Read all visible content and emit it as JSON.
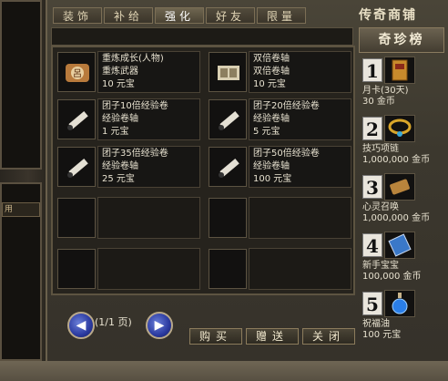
{
  "tabs": [
    {
      "label": "装饰",
      "active": false
    },
    {
      "label": "补给",
      "active": false
    },
    {
      "label": "强化",
      "active": true
    },
    {
      "label": "好友",
      "active": false
    },
    {
      "label": "限量",
      "active": false
    }
  ],
  "shop_title": "传奇商铺",
  "left_panel_fragment": "用",
  "items": [
    {
      "icon": "scroll-seal-icon",
      "name": "重炼成长(人物)",
      "desc": "重炼武器",
      "price": "10 元宝"
    },
    {
      "icon": "double-scroll-icon",
      "name": "双倍卷轴",
      "desc": "双倍卷轴",
      "price": "10 元宝"
    },
    {
      "icon": "exp-scroll-icon",
      "name": "团子10倍经验卷",
      "desc": "经验卷轴",
      "price": "1 元宝"
    },
    {
      "icon": "exp-scroll-icon",
      "name": "团子20倍经验卷",
      "desc": "经验卷轴",
      "price": "5 元宝"
    },
    {
      "icon": "exp-scroll-icon",
      "name": "团子35倍经验卷",
      "desc": "经验卷轴",
      "price": "25 元宝"
    },
    {
      "icon": "exp-scroll-icon",
      "name": "团子50倍经验卷",
      "desc": "经验卷轴",
      "price": "100 元宝"
    }
  ],
  "pagination": {
    "text": "(1/1 页)",
    "prev_glyph": "◀",
    "next_glyph": "▶"
  },
  "buttons": {
    "buy": "购买",
    "gift": "赠送",
    "close": "关闭"
  },
  "ranking": {
    "title": "奇珍榜",
    "items": [
      {
        "rank": "1",
        "icon": "card-icon",
        "name": "月卡(30天)",
        "price": "30 金币"
      },
      {
        "rank": "2",
        "icon": "necklace-icon",
        "name": "技巧项链",
        "price": "1,000,000 金币"
      },
      {
        "rank": "3",
        "icon": "summon-scroll-icon",
        "name": "心灵召唤",
        "price": "1,000,000 金币"
      },
      {
        "rank": "4",
        "icon": "treasure-scroll-icon",
        "name": "新手宝宝",
        "price": "100,000 金币"
      },
      {
        "rank": "5",
        "icon": "potion-icon",
        "name": "祝福油",
        "price": "100 元宝"
      }
    ]
  },
  "colors": {
    "accent_blue": "#2b3aa0",
    "frame": "#4a4538",
    "text": "#e8e2d0"
  }
}
